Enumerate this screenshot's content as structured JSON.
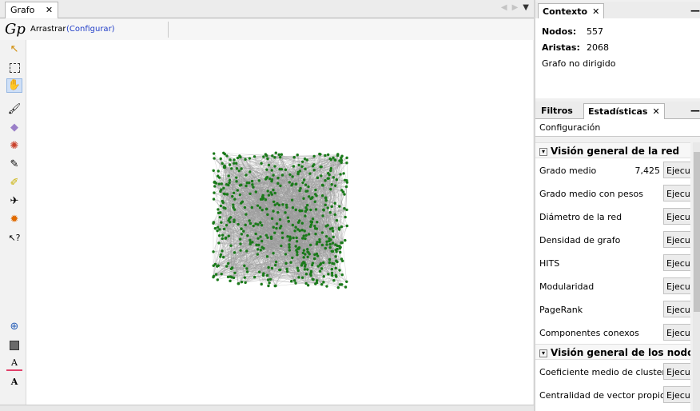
{
  "graph_window": {
    "tab_label": "Grafo",
    "tab_close": "✕",
    "toolbar": {
      "logo": "Gp",
      "drag_label": "Arrastrar",
      "config_link": "(Configurar)"
    },
    "tools": [
      "cursor-arrow-icon",
      "rect-select-icon",
      "drag-hand-icon",
      "brush-icon",
      "diamond-icon",
      "color-wheel-icon",
      "pencil-icon",
      "highlighter-icon",
      "airplane-icon",
      "gear-icon",
      "help-pointer-icon",
      "zoom-icon",
      "square-color-icon",
      "text-color-icon",
      "text-size-icon"
    ],
    "node_color": "#1a7a1a",
    "edge_color": "#9a9a9a"
  },
  "context": {
    "tab_label": "Contexto",
    "tab_close": "✕",
    "nodes_label": "Nodos:",
    "nodes_value": "557",
    "edges_label": "Aristas:",
    "edges_value": "2068",
    "graph_type": "Grafo no dirigido"
  },
  "stats": {
    "filters_tab": "Filtros",
    "stats_tab": "Estadísticas",
    "tab_close": "✕",
    "config_label": "Configuración",
    "run_label": "Ejecutar",
    "network_section": "Visión general de la red",
    "network_items": [
      {
        "name": "Grado medio",
        "value": "7,425"
      },
      {
        "name": "Grado medio con pesos",
        "value": ""
      },
      {
        "name": "Diámetro de la red",
        "value": ""
      },
      {
        "name": "Densidad de grafo",
        "value": ""
      },
      {
        "name": "HITS",
        "value": ""
      },
      {
        "name": "Modularidad",
        "value": ""
      },
      {
        "name": "PageRank",
        "value": ""
      },
      {
        "name": "Componentes conexos",
        "value": ""
      }
    ],
    "nodes_section": "Visión general de los nodos",
    "node_items": [
      {
        "name": "Coeficiente medio de clustering",
        "value": ""
      },
      {
        "name": "Centralidad de vector propio",
        "value": ""
      }
    ]
  }
}
